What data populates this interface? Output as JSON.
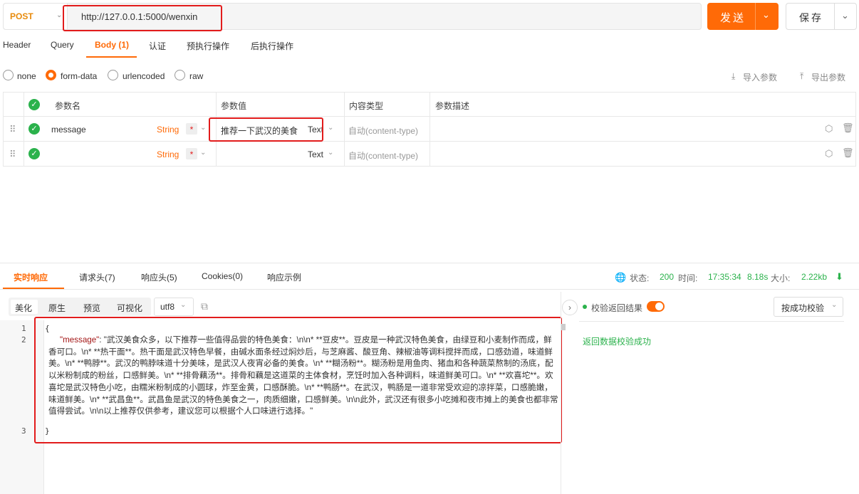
{
  "request": {
    "method": "POST",
    "url": "http://127.0.0.1:5000/wenxin",
    "send_label": "发送",
    "save_label": "保存"
  },
  "request_tabs": [
    "Header",
    "Query",
    "Body (1)",
    "认证",
    "预执行操作",
    "后执行操作"
  ],
  "body_types": [
    "none",
    "form-data",
    "urlencoded",
    "raw"
  ],
  "selected_body_type": "form-data",
  "import_label": "导入参数",
  "export_label": "导出参数",
  "params_table": {
    "headers": [
      "参数名",
      "参数值",
      "内容类型",
      "参数描述"
    ],
    "rows": [
      {
        "name": "message",
        "type": "String",
        "required": "*",
        "value": "推荐一下武汉的美食",
        "value_type": "Text",
        "content_type": "自动(content-type)"
      },
      {
        "name": "",
        "type": "String",
        "required": "*",
        "value": "",
        "value_type": "Text",
        "content_type": "自动(content-type)"
      }
    ]
  },
  "response_tabs": [
    "实时响应",
    "请求头(7)",
    "响应头(5)",
    "Cookies(0)",
    "响应示例"
  ],
  "response_status": {
    "status_label": "状态:",
    "status": "200",
    "time_label": "时间:",
    "time": "17:35:34",
    "duration": "8.18s",
    "size_label": "大小:",
    "size": "2.22kb"
  },
  "viewer_tabs": [
    "美化",
    "原生",
    "预览",
    "可视化"
  ],
  "encoding": "utf8",
  "code": {
    "line_numbers": [
      "1",
      "2",
      "3"
    ],
    "open_brace": "{",
    "close_brace": "}",
    "key": "\"message\"",
    "colon": ": ",
    "value": "\"武汉美食众多，以下推荐一些值得品尝的特色美食：\\n\\n* **豆皮**。豆皮是一种武汉特色美食，由绿豆和小麦制作而成，鲜香可口。\\n* **热干面**。热干面是武汉特色早餐，由碱水面条经过焖炒后，与芝麻酱、酸豆角、辣椒油等调料搅拌而成，口感劲道，味道鲜美。\\n* **鸭脖**。武汉的鸭脖味道十分美味，是武汉人夜宵必备的美食。\\n* **糊汤粉**。糊汤粉是用鱼肉、猪血和各种蔬菜熬制的汤底，配以米粉制成的粉丝，口感鲜美。\\n* **排骨藕汤**。排骨和藕是这道菜的主体食材，烹饪时加入各种调料，味道鲜美可口。\\n* **欢喜坨**。欢喜坨是武汉特色小吃，由糯米粉制成的小圆球，炸至金黄，口感酥脆。\\n* **鸭肠**。在武汉，鸭肠是一道非常受欢迎的凉拌菜，口感脆嫩，味道鲜美。\\n* **武昌鱼**。武昌鱼是武汉的特色美食之一，肉质细嫩，口感鲜美。\\n\\n此外，武汉还有很多小吃摊和夜市摊上的美食也都非常值得尝试。\\n\\n以上推荐仅供参考，建议您可以根据个人口味进行选择。\""
  },
  "validation": {
    "label": "校验返回结果",
    "mode": "按成功校验",
    "result": "返回数据校验成功"
  },
  "colors": {
    "accent": "#ff6a07",
    "success": "#2bb24c",
    "highlight": "#e21c1c"
  }
}
